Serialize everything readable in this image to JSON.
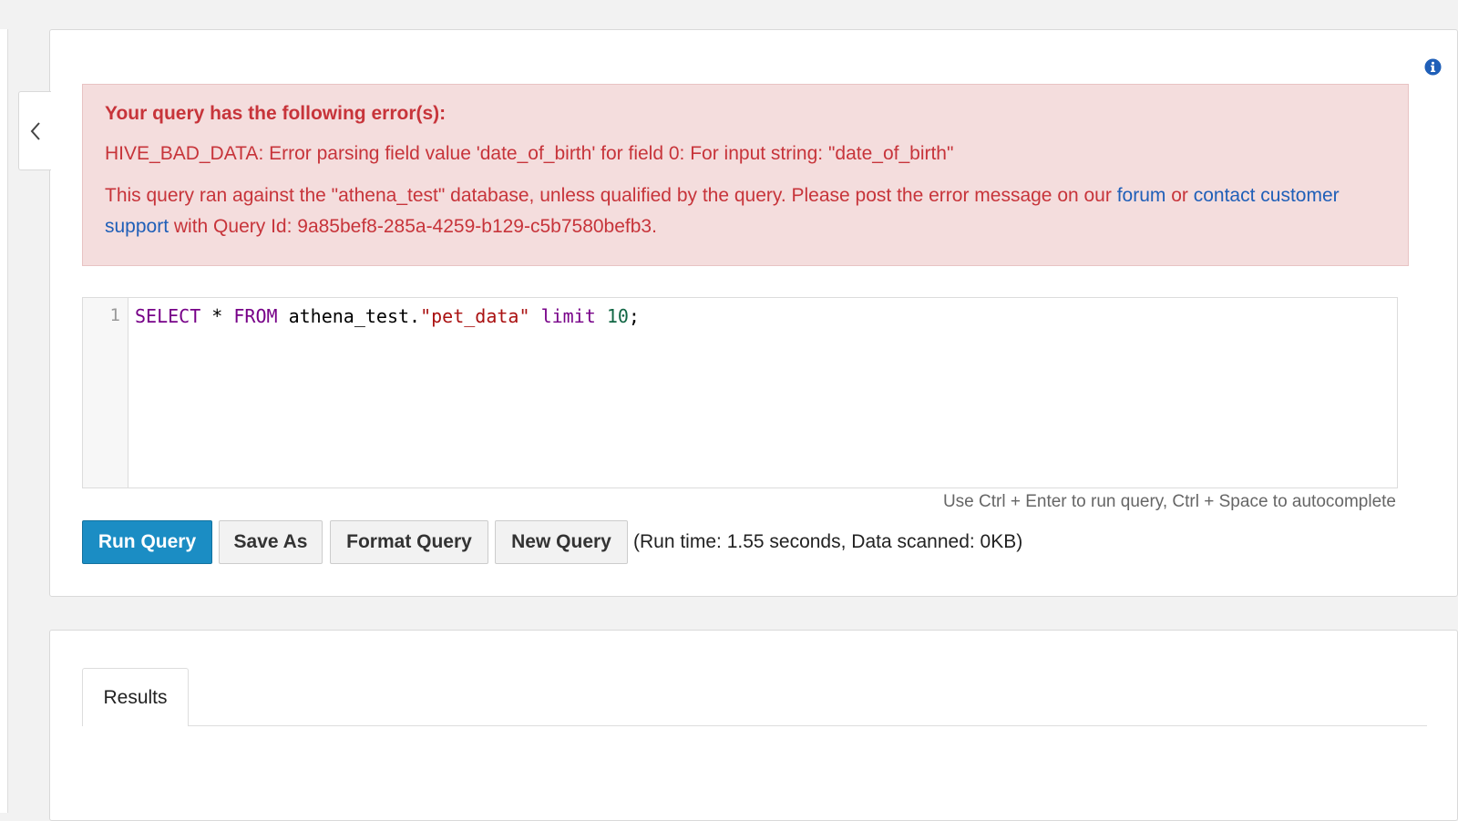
{
  "error": {
    "title": "Your query has the following error(s):",
    "detail": "HIVE_BAD_DATA: Error parsing field value 'date_of_birth' for field 0: For input string: \"date_of_birth\"",
    "message_prefix": "This query ran against the \"athena_test\" database, unless qualified by the query. Please post the error message on our ",
    "forum_link": "forum",
    "or_text": " or ",
    "contact_link": "contact customer support",
    "message_suffix": " with Query Id: 9a85bef8-285a-4259-b129-c5b7580befb3."
  },
  "editor": {
    "line_number": "1",
    "tokens": {
      "kw_select": "SELECT",
      "op_star": " * ",
      "kw_from": "FROM",
      "table_ref": " athena_test.",
      "str_table": "\"pet_data\"",
      "space": " ",
      "kw_limit": "limit",
      "space2": " ",
      "num_limit": "10",
      "semicolon": ";"
    }
  },
  "hint": "Use Ctrl + Enter to run query, Ctrl + Space to autocomplete",
  "toolbar": {
    "run_label": "Run Query",
    "save_as_label": "Save As",
    "format_label": "Format Query",
    "new_label": "New Query",
    "runtime_text": "(Run time: 1.55 seconds, Data scanned: 0KB)"
  },
  "results": {
    "tab_label": "Results"
  },
  "icons": {
    "collapse": "chevron-left-icon",
    "info": "info-icon"
  },
  "colors": {
    "error_text": "#c7343a",
    "error_bg": "#f4dddd",
    "link": "#1f5fb8",
    "primary_button": "#1b8dc4"
  }
}
